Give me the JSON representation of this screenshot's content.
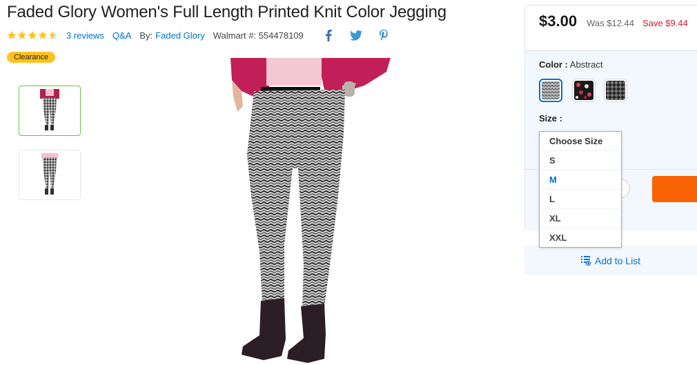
{
  "product": {
    "title": "Faded Glory Women's Full Length Printed Knit Color Jegging",
    "rating": 4.5,
    "reviews_label": "3 reviews",
    "qa_label": "Q&A",
    "by_label": "By:",
    "brand": "Faded Glory",
    "walmart_number": "Walmart #: 554478109",
    "badge": "Clearance"
  },
  "social": [
    "facebook-icon",
    "twitter-icon",
    "pinterest-icon"
  ],
  "pricing": {
    "price": "$3.00",
    "was": "Was $12.44",
    "save": "Save $9.44"
  },
  "options": {
    "color_label": "Color :",
    "color_value": "Abstract",
    "size_label": "Size :",
    "size_dropdown": [
      "Choose Size",
      "S",
      "M",
      "L",
      "XL",
      "XXL"
    ],
    "highlighted_size": "M"
  },
  "actions": {
    "add_to_list": "Add to List"
  },
  "colors": {
    "accent": "#0071ce",
    "badge": "#ffc220",
    "save_red": "#de1c24",
    "cart_orange": "#f96302",
    "thumb_active": "#76c043"
  }
}
